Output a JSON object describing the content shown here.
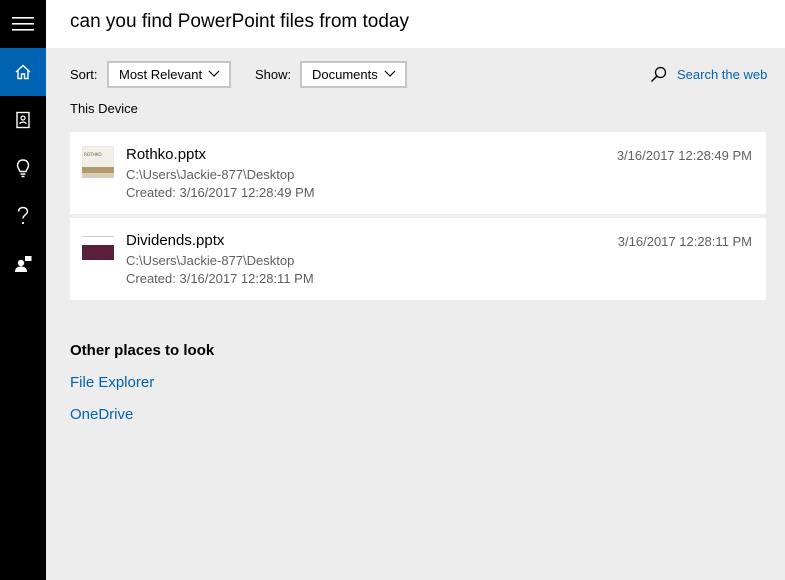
{
  "query": "can you find PowerPoint files from today",
  "filters": {
    "sort_label": "Sort:",
    "sort_value": "Most Relevant",
    "show_label": "Show:",
    "show_value": "Documents"
  },
  "search_web": "Search the web",
  "section": "This Device",
  "results": [
    {
      "name": "Rothko.pptx",
      "path": "C:\\Users\\Jackie-877\\Desktop",
      "created": "Created: 3/16/2017 12:28:49 PM",
      "date": "3/16/2017 12:28:49 PM",
      "thumb_text": "ROTHKO"
    },
    {
      "name": "Dividends.pptx",
      "path": "C:\\Users\\Jackie-877\\Desktop",
      "created": "Created: 3/16/2017 12:28:11 PM",
      "date": "3/16/2017 12:28:11 PM"
    }
  ],
  "other_places": {
    "heading": "Other places to look",
    "links": [
      "File Explorer",
      "OneDrive"
    ]
  },
  "nav_icons": [
    "hamburger-icon",
    "home-icon",
    "notebook-icon",
    "lightbulb-icon",
    "help-icon",
    "feedback-icon"
  ],
  "colors": {
    "accent": "#0063b1",
    "rail": "#000000",
    "background": "#ededed"
  }
}
